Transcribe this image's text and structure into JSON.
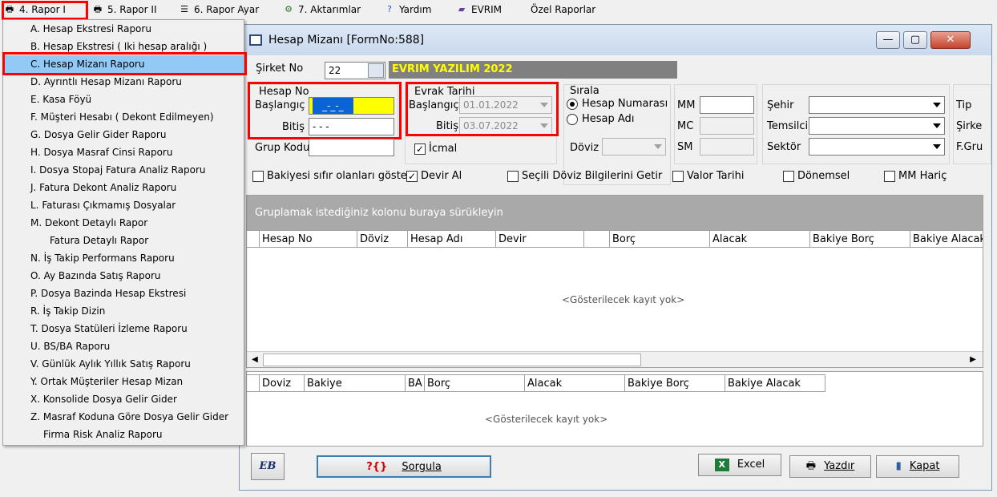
{
  "menubar": {
    "items": [
      {
        "label": "4.  Rapor I",
        "icon": "printer-icon"
      },
      {
        "label": "5.  Rapor II",
        "icon": "printer-icon"
      },
      {
        "label": "6.  Rapor Ayar",
        "icon": "report-settings-icon"
      },
      {
        "label": "7.  Aktarımlar",
        "icon": "transfer-icon"
      },
      {
        "label": "Yardım",
        "icon": "help-icon"
      },
      {
        "label": "EVRIM",
        "icon": "book-icon"
      },
      {
        "label": "Özel Raporlar",
        "icon": ""
      }
    ]
  },
  "dropdown": {
    "items": [
      "A.  Hesap Ekstresi Raporu",
      "B.  Hesap Ekstresi ( Iki hesap aralığı )",
      "C.  Hesap Mizanı Raporu",
      "D.  Ayrıntlı Hesap Mizanı Raporu",
      "E.  Kasa Föyü",
      "F.  Müşteri Hesabı ( Dekont Edilmeyen)",
      "G.  Dosya Gelir Gider Raporu",
      "H.  Dosya Masraf Cinsi Raporu",
      "I.  Dosya Stopaj Fatura Analiz Raporu",
      "J.  Fatura Dekont Analiz Raporu",
      "L.  Faturası Çıkmamış Dosyalar",
      "M.   Dekont Detaylı Rapor",
      "Fatura Detaylı Rapor",
      "N.  İş Takip Performans Raporu",
      "O.   Ay Bazında Satış Raporu",
      "P.   Dosya Bazinda Hesap Ekstresi",
      "R.   İş Takip Dizin",
      "T.  Dosya Statüleri İzleme Raporu",
      "U.  BS/BA Raporu",
      "V. Günlük Aylık Yıllık Satış Raporu",
      "Y. Ortak Müşteriler Hesap Mizan",
      "X. Konsolide Dosya Gelir Gider",
      "Z. Masraf Koduna Göre Dosya Gelir Gider",
      "Firma Risk Analiz Raporu"
    ]
  },
  "window": {
    "title": "Hesap Mizanı [FormNo:588]",
    "minimize": "—",
    "maximize": "▢",
    "close": "✕"
  },
  "form": {
    "sirket_label": "Şirket No",
    "sirket_value": "22",
    "company_name": "EVRIM YAZILIM  2022",
    "hesap_no_title": "Hesap No",
    "baslangic_label": "Başlangıç",
    "bitis_label": "Bitiş",
    "hesap_baslangic_value": "_-_-_",
    "hesap_bitis_value": " - - -",
    "grup_kodu_label": "Grup Kodu",
    "evrak_tarihi_title": "Evrak Tarihi",
    "evrak_baslangic_value": "01.01.2022",
    "evrak_bitis_value": "03.07.2022",
    "icmal_label": "İcmal",
    "sirala_title": "Sırala",
    "sirala_options": [
      "Hesap Numarası",
      "Hesap Adı"
    ],
    "doviz_label": "Döviz",
    "mm_label": "MM",
    "mc_label": "MC",
    "sm_label": "SM",
    "sehir_label": "Şehir",
    "temsilci_label": "Temsilci",
    "sektor_label": "Sektör",
    "tip_label": "Tip",
    "sirket_label2": "Şirke",
    "fgru_label": "F.Gru"
  },
  "checks": [
    {
      "label": "Bakiyesi sıfır olanları göster",
      "checked": false
    },
    {
      "label": "Devir Al",
      "checked": true
    },
    {
      "label": "Seçili Döviz Bilgilerini Getir",
      "checked": false
    },
    {
      "label": "Valor Tarihi",
      "checked": false
    },
    {
      "label": "Dönemsel",
      "checked": false
    },
    {
      "label": "MM Hariç",
      "checked": false
    }
  ],
  "grid1": {
    "group_hint": "Gruplamak istediğiniz kolonu buraya sürükleyin",
    "headers": [
      "Hesap No",
      "Döviz",
      "Hesap Adı",
      "Devir",
      "",
      "Borç",
      "Alacak",
      "Bakiye Borç",
      "Bakiye Alacak"
    ],
    "empty": "<Gösterilecek kayıt yok>"
  },
  "grid2": {
    "headers": [
      "Doviz",
      "Bakiye",
      "BA",
      "Borç",
      "Alacak",
      "Bakiye Borç",
      "Bakiye Alacak"
    ],
    "empty": "<Gösterilecek kayıt yok>"
  },
  "buttons": {
    "eb_label": "EB",
    "sorgula_icon": "?{}",
    "sorgula": "Sorgula",
    "excel": "Excel",
    "yazdir": "Yazdır",
    "kapat": "Kapat"
  },
  "colors": {
    "highlight": "#ff0000",
    "selected_item": "#91c9f7",
    "company_text": "#ffff00",
    "company_bg": "#808080",
    "grid_group_bar": "#a9a9a9"
  }
}
